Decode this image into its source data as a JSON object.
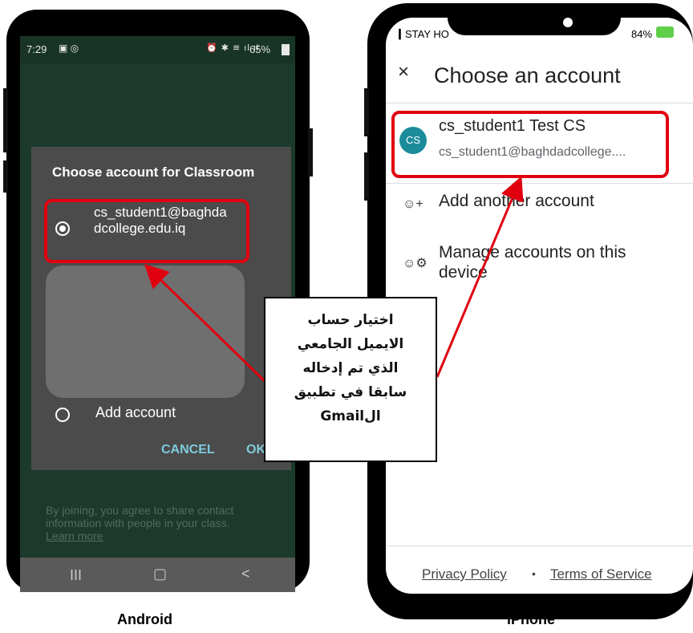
{
  "android": {
    "status": {
      "time": "7:29",
      "right": "65%"
    },
    "dialog": {
      "title": "Choose account for Classroom",
      "account_email": "cs_student1@baghdadcollege.edu.iq",
      "add_account": "Add account",
      "cancel": "CANCEL",
      "ok": "OK"
    },
    "footer": {
      "text": "By joining, you agree to share contact information with people in your class.",
      "learn_more": "Learn more"
    },
    "nav": {
      "recents": "III",
      "home": "▢",
      "back": "<"
    }
  },
  "iphone": {
    "status": {
      "carrier": "STAY HO",
      "battery": "84%"
    },
    "title": "Choose an account",
    "close": "×",
    "account": {
      "avatar": "CS",
      "name": "cs_student1 Test CS",
      "email": "cs_student1@baghdadcollege...."
    },
    "add_another": "Add another account",
    "manage": "Manage accounts on this device",
    "footer": {
      "privacy": "Privacy Policy",
      "dot": "•",
      "terms": "Terms of Service"
    }
  },
  "callout": {
    "line1": "اختيار حساب",
    "line2": "الايميل الجامعي",
    "line3": "الذي تم إدخاله",
    "line4": "سابقا في تطبيق",
    "line5": "الGmail"
  },
  "captions": {
    "android": "Android",
    "iphone": "iPhone"
  },
  "colors": {
    "highlight": "#e00010",
    "android_bg": "#1b3a2c",
    "dialog_bg": "#4b4b4b",
    "accent": "#7ecbdc",
    "avatar": "#1c8c9b"
  }
}
